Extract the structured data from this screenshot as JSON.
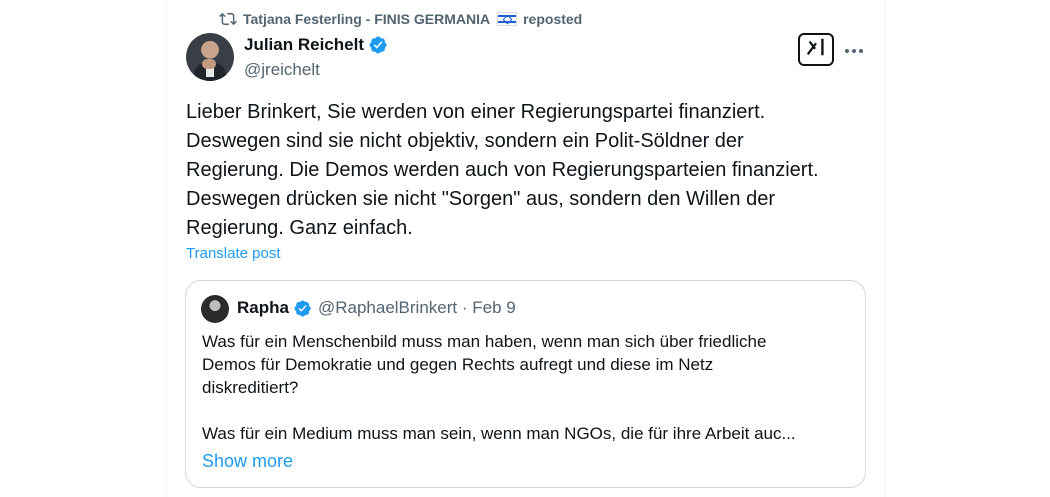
{
  "repost": {
    "text": "Tatjana Festerling - FINIS GERMANIA",
    "suffix": "reposted",
    "icon": "repost-icon",
    "flag": "flag-of-israel"
  },
  "post": {
    "author_name": "Julian Reichelt",
    "handle": "@jreichelt",
    "verified_icon": "verified-badge-icon",
    "grok_icon": "grok-icon",
    "more_icon": "more-icon",
    "text": "Lieber Brinkert, Sie werden von einer Regierungspartei finanziert.\nDeswegen sind sie nicht objektiv, sondern ein Polit-Söldner der\nRegierung. Die Demos werden auch von Regierungsparteien finanziert.\nDeswegen drücken sie nicht \"Sorgen\" aus, sondern den Willen der\nRegierung. Ganz einfach.",
    "translate_label": "Translate post"
  },
  "quote": {
    "name": "Rapha",
    "meta": "@RaphaelBrinkert · Feb 9",
    "text": "Was für ein Menschenbild muss man haben, wenn man sich über friedliche\nDemos für Demokratie und gegen Rechts aufregt und diese im Netz\ndiskreditiert?\n\nWas für ein Medium muss man sein, wenn man NGOs, die für ihre Arbeit auc...",
    "show_more_label": "Show more"
  },
  "colors": {
    "accent": "#1d9bf0",
    "secondary_text": "#536471",
    "primary_text": "#0f1419",
    "border": "#cfd9de"
  }
}
